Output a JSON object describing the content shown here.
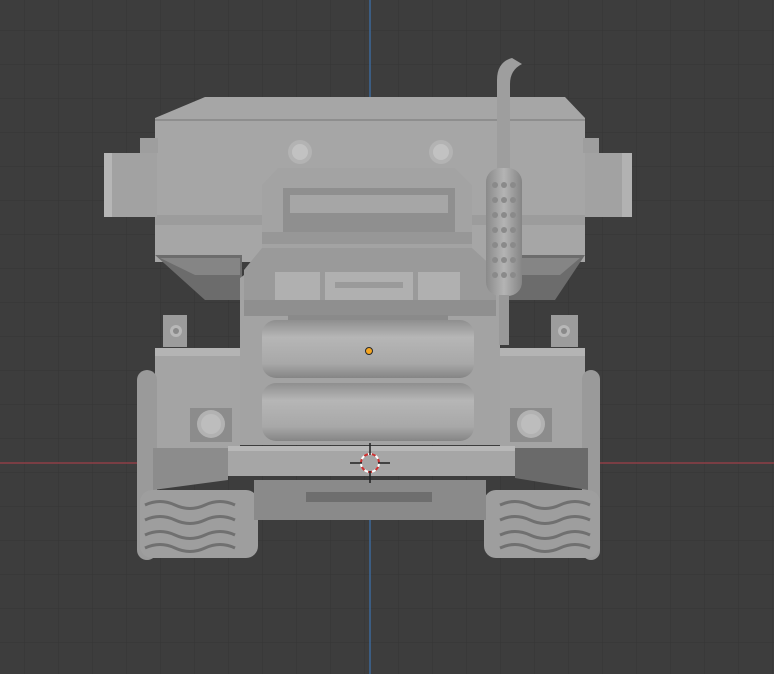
{
  "viewport": {
    "background": "#3d3d3d",
    "grid_color": "#353535",
    "x_axis_color": "#a0404a",
    "z_axis_color": "#3d73b0",
    "origin_color": "#f5a51f",
    "cursor_color": "#d03030"
  },
  "model": {
    "object": "dump-truck",
    "view": "front",
    "shade_light": "#b0b0b0",
    "shade_mid": "#9a9a9a",
    "shade_dark": "#7a7a7a",
    "shade_shadow": "#5a5a5a"
  }
}
